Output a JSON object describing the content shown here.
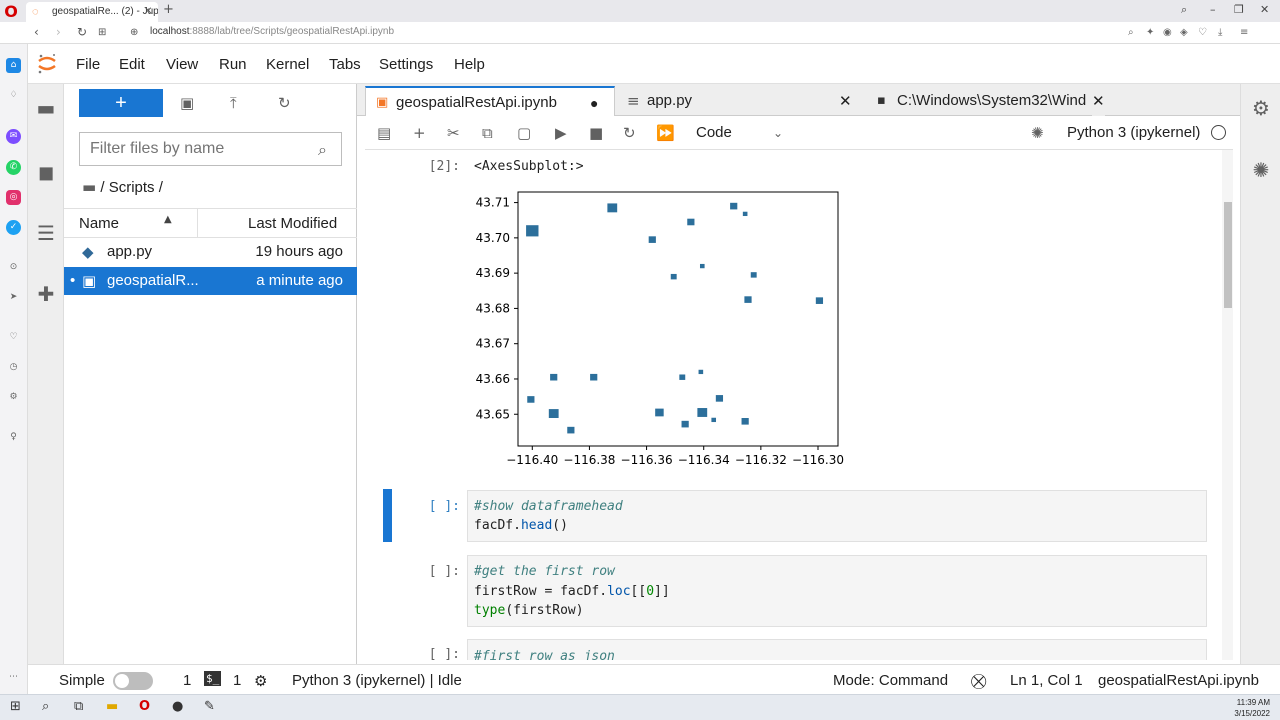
{
  "browser": {
    "tab_title": "geospatialRe... (2) - Jupyte",
    "url_host": "localhost",
    "url_rest": ":8888/lab/tree/Scripts/geospatialRestApi.ipynb"
  },
  "menu": [
    "File",
    "Edit",
    "View",
    "Run",
    "Kernel",
    "Tabs",
    "Settings",
    "Help"
  ],
  "filebrowser": {
    "new_label": "+",
    "filter_placeholder": "Filter files by name",
    "breadcrumb": "/ Scripts /",
    "col_name": "Name",
    "col_modified": "Last Modified",
    "files": [
      {
        "name": "app.py",
        "modified": "19 hours ago",
        "icon": "python-icon"
      },
      {
        "name": "geospatialR...",
        "modified": "a minute ago",
        "icon": "notebook-icon",
        "selected": true
      }
    ]
  },
  "doc_tabs": [
    {
      "label": "geospatialRestApi.ipynb",
      "icon": "notebook-icon",
      "active": true,
      "dirty": true
    },
    {
      "label": "app.py",
      "icon": "file-icon"
    },
    {
      "label": "C:\\Windows\\System32\\Wind",
      "icon": "terminal-icon"
    }
  ],
  "toolbar": {
    "cell_type": "Code",
    "kernel": "Python 3 (ipykernel)"
  },
  "cells": {
    "out2_prompt": "[2]:",
    "out2_text": "<AxesSubplot:>",
    "c3_prompt": "[ ]:",
    "c3_lines": [
      "#show dataframehead",
      "facDf.head()"
    ],
    "c4_prompt": "[ ]:",
    "c4_lines": [
      "#get the first row",
      "firstRow = facDf.loc[[0]]",
      "type(firstRow)"
    ],
    "c5_prompt": "[ ]:",
    "c5_line": "#first row as json"
  },
  "chart_data": {
    "type": "scatter",
    "title": "",
    "xlabel": "",
    "ylabel": "",
    "xlim": [
      -116.405,
      -116.293
    ],
    "ylim": [
      43.641,
      43.713
    ],
    "x_ticks": [
      "−116.40",
      "−116.38",
      "−116.36",
      "−116.34",
      "−116.32",
      "−116.30"
    ],
    "x_tick_values": [
      -116.4,
      -116.38,
      -116.36,
      -116.34,
      -116.32,
      -116.3
    ],
    "y_ticks": [
      "43.71",
      "43.70",
      "43.69",
      "43.68",
      "43.67",
      "43.66",
      "43.65"
    ],
    "y_tick_values": [
      43.71,
      43.7,
      43.69,
      43.68,
      43.67,
      43.66,
      43.65
    ],
    "color": "#2c6f9b",
    "shapes": [
      {
        "x": -116.4,
        "y": 43.702,
        "size": 4
      },
      {
        "x": -116.372,
        "y": 43.7085,
        "size": 3
      },
      {
        "x": -116.358,
        "y": 43.6995,
        "size": 2
      },
      {
        "x": -116.3445,
        "y": 43.7045,
        "size": 2
      },
      {
        "x": -116.3295,
        "y": 43.709,
        "size": 2
      },
      {
        "x": -116.3255,
        "y": 43.7068,
        "size": 1
      },
      {
        "x": -116.3405,
        "y": 43.692,
        "size": 1
      },
      {
        "x": -116.3505,
        "y": 43.689,
        "size": 1.5
      },
      {
        "x": -116.3225,
        "y": 43.6895,
        "size": 1.5
      },
      {
        "x": -116.3245,
        "y": 43.6825,
        "size": 2
      },
      {
        "x": -116.2995,
        "y": 43.6822,
        "size": 2
      },
      {
        "x": -116.3925,
        "y": 43.6605,
        "size": 2
      },
      {
        "x": -116.3785,
        "y": 43.6605,
        "size": 2
      },
      {
        "x": -116.3475,
        "y": 43.6605,
        "size": 1.5
      },
      {
        "x": -116.341,
        "y": 43.662,
        "size": 1
      },
      {
        "x": -116.4005,
        "y": 43.6542,
        "size": 2
      },
      {
        "x": -116.3925,
        "y": 43.6502,
        "size": 3
      },
      {
        "x": -116.3865,
        "y": 43.6455,
        "size": 2
      },
      {
        "x": -116.3555,
        "y": 43.6505,
        "size": 2.5
      },
      {
        "x": -116.3465,
        "y": 43.6472,
        "size": 2
      },
      {
        "x": -116.3405,
        "y": 43.6505,
        "size": 3
      },
      {
        "x": -116.3345,
        "y": 43.6545,
        "size": 2
      },
      {
        "x": -116.3255,
        "y": 43.648,
        "size": 2
      },
      {
        "x": -116.3365,
        "y": 43.6484,
        "size": 1
      }
    ]
  },
  "statusbar": {
    "simple": "Simple",
    "count1": "1",
    "count2": "1",
    "kernel_status": "Python 3 (ipykernel) | Idle",
    "mode": "Mode: Command",
    "position": "Ln 1, Col 1",
    "filename": "geospatialRestApi.ipynb"
  },
  "taskbar": {
    "time": "11:39 AM",
    "date": "3/15/2022"
  }
}
